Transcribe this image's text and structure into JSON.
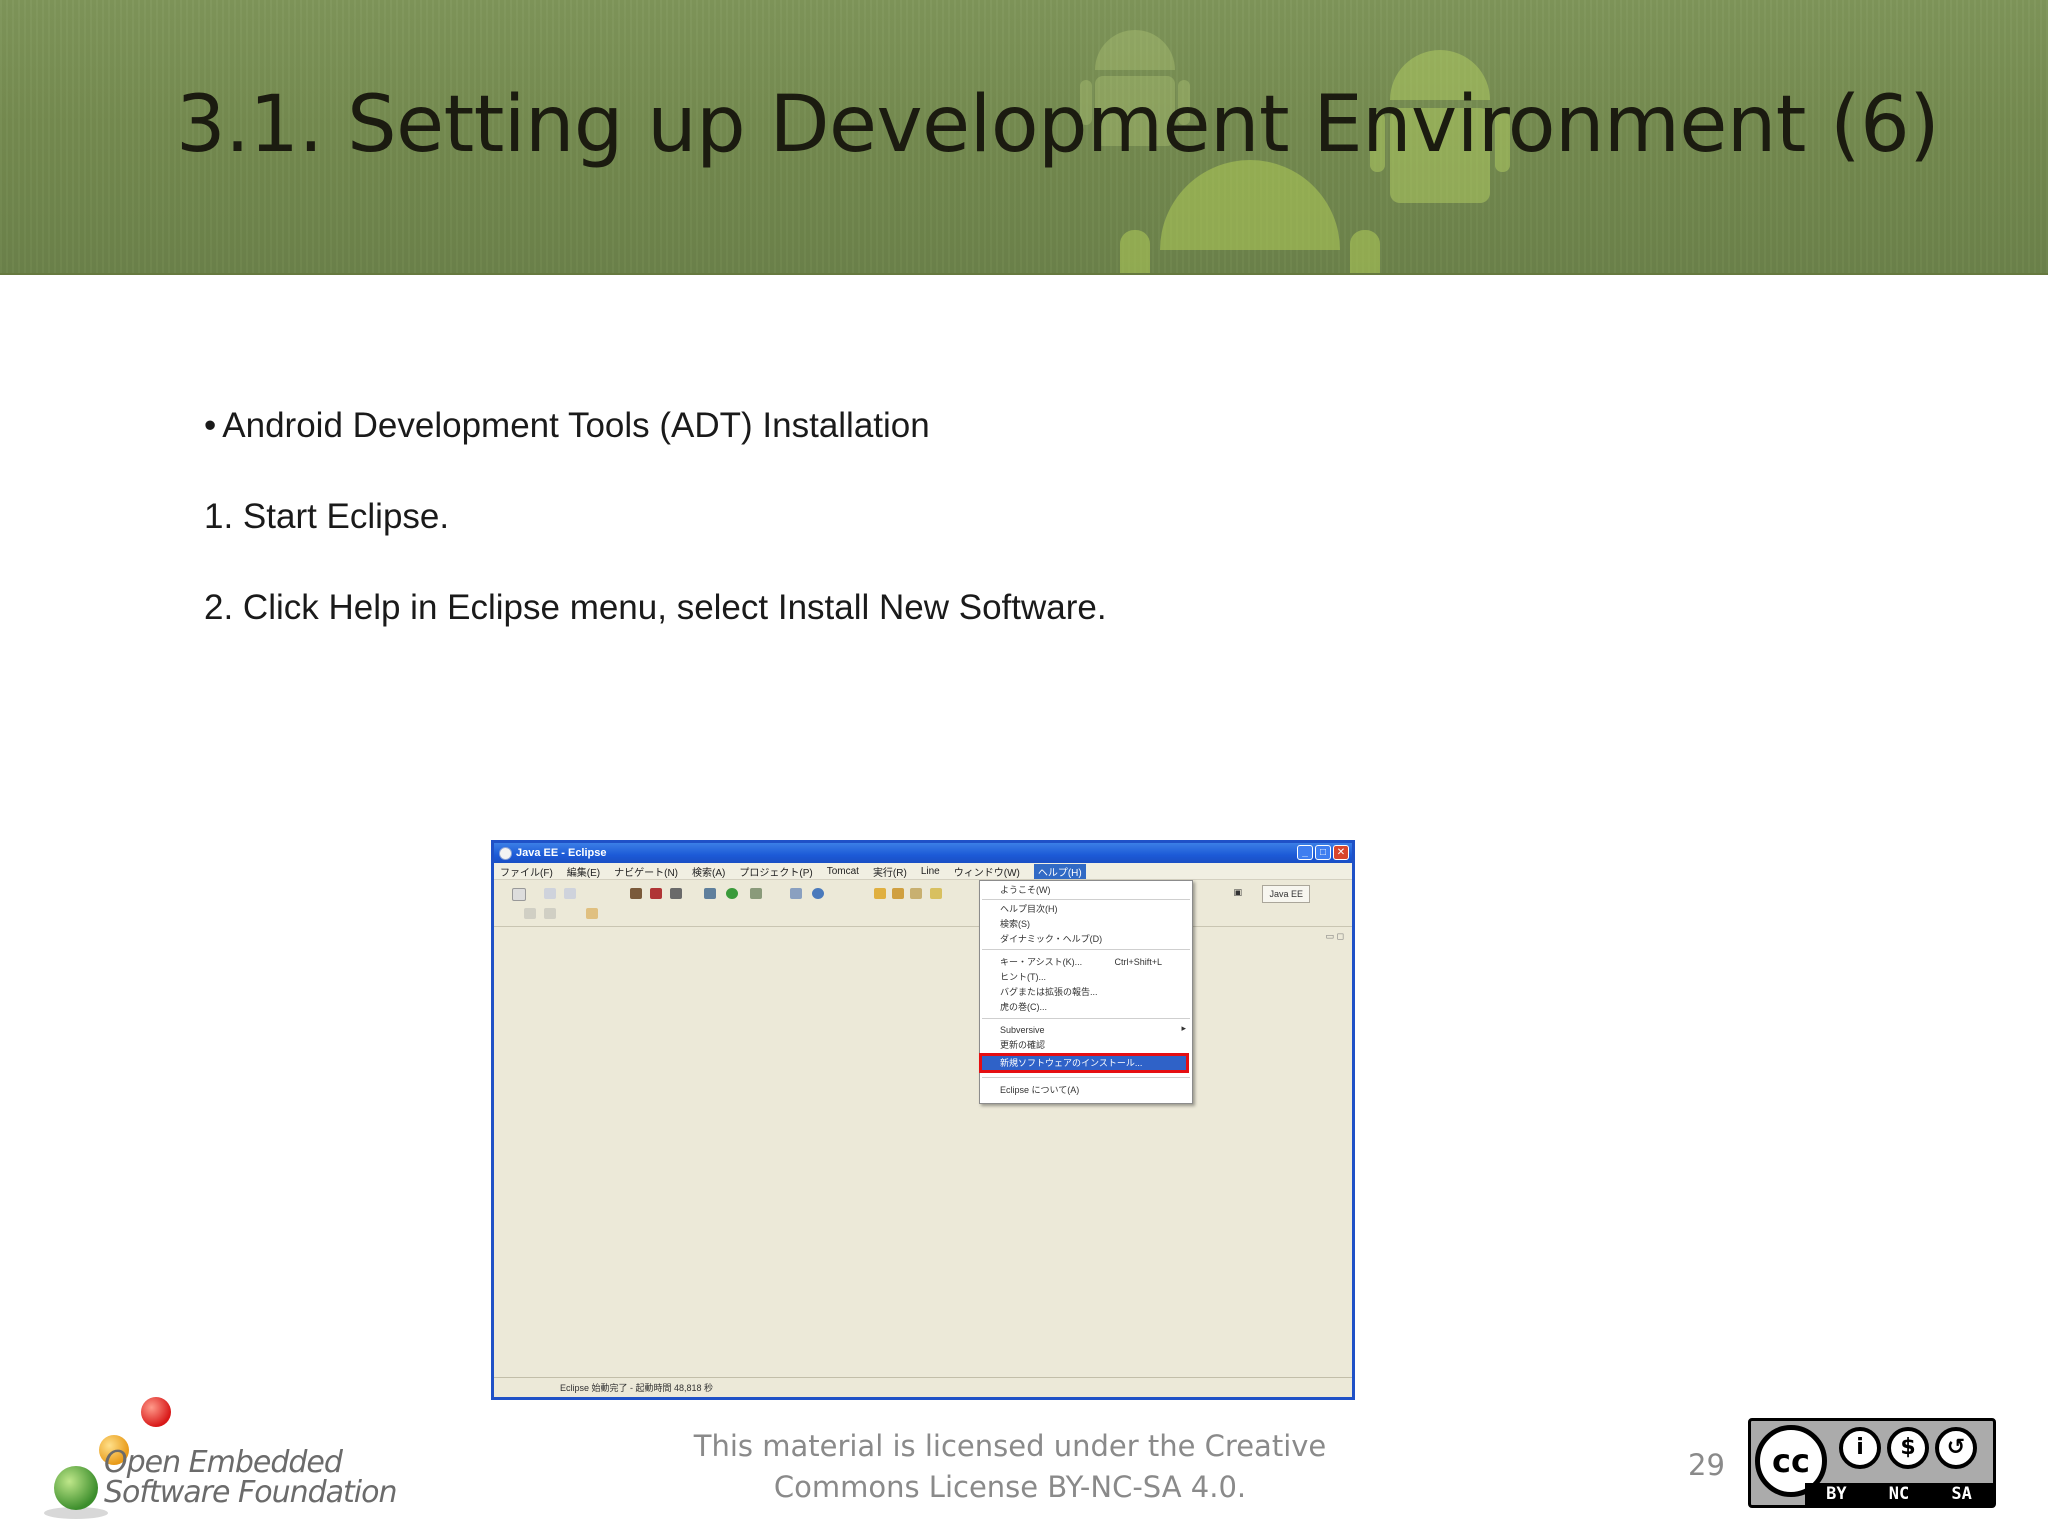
{
  "slide": {
    "title": "3.1. Setting up Development Environment (6)",
    "bullet_symbol": "•",
    "bullet": "Android Development Tools (ADT) Installation",
    "steps": [
      "1. Start Eclipse.",
      "2. Click Help in Eclipse menu, select Install New Software."
    ],
    "license": [
      "This material is licensed under the Creative",
      "Commons License BY-NC-SA 4.0."
    ],
    "page_number": "29"
  },
  "logo": {
    "lines": [
      "Open Embedded",
      "Software Foundation"
    ]
  },
  "cc_badge": {
    "cc": "cc",
    "labels": [
      "BY",
      "NC",
      "SA"
    ]
  },
  "screenshot": {
    "window_title": "Java EE - Eclipse",
    "window_buttons": [
      "_",
      "□",
      "✕"
    ],
    "menubar": [
      "ファイル(F)",
      "編集(E)",
      "ナビゲート(N)",
      "検索(A)",
      "プロジェクト(P)",
      "Tomcat",
      "実行(R)",
      "Line",
      "ウィンドウ(W)",
      "ヘルプ(H)"
    ],
    "perspective_label": "Java EE",
    "status_text": "Eclipse 始動完了 - 起動時間 48,818 秒",
    "help_menu": {
      "items": [
        "ようこそ(W)",
        "ヘルプ目次(H)",
        "検索(S)",
        "ダイナミック・ヘルプ(D)",
        "キー・アシスト(K)...",
        "ヒント(T)...",
        "バグまたは拡張の報告...",
        "虎の巻(C)...",
        "Subversive",
        "更新の確認",
        "新規ソフトウェアのインストール...",
        "Eclipse について(A)"
      ],
      "key_assist_shortcut": "Ctrl+Shift+L",
      "highlighted_index": 10
    }
  },
  "colors": {
    "header_bg": "#758b50",
    "title": "#1b1b10",
    "eclipse_title_blue": "#1c5ad7",
    "highlight_red": "#e50e12",
    "logo_green": "#4fa23a",
    "logo_orange": "#f0a020",
    "logo_red": "#e02020"
  }
}
